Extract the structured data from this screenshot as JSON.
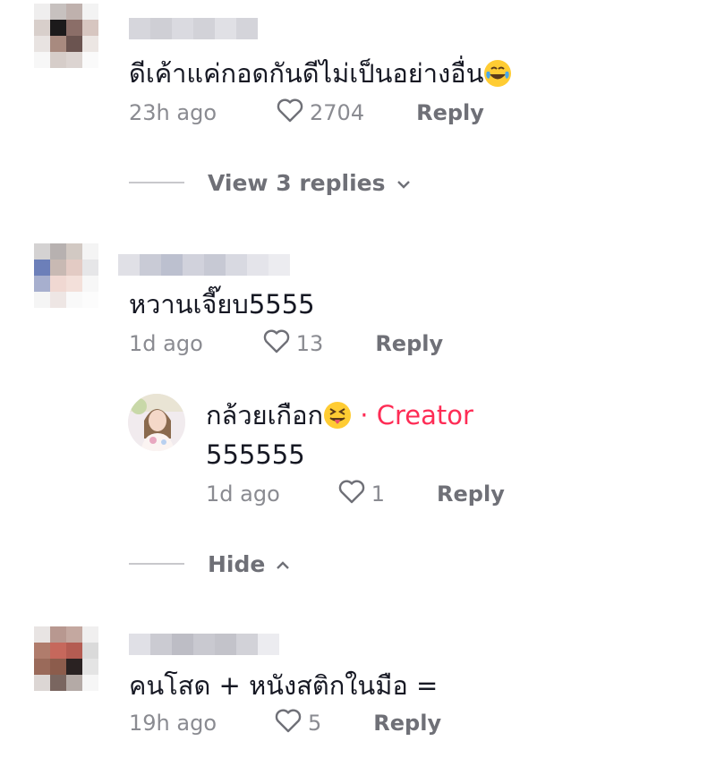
{
  "comments": [
    {
      "text": "ดีเค้าแค่กอดกันดีไม่เป็นอย่างอื่น",
      "emoji": "laughing-tears-emoji",
      "time": "23h ago",
      "likes": "2704",
      "reply_label": "Reply",
      "toggle_label": "View 3 replies",
      "toggle_icon": "chevron-down-icon"
    },
    {
      "text": "หวานเจี๊ยบ5555",
      "time": "1d ago",
      "likes": "13",
      "reply_label": "Reply",
      "replies": [
        {
          "author": "กล้วยเกือก",
          "author_emoji": "tongue-out-emoji",
          "badge": "· Creator",
          "text": "555555",
          "time": "1d ago",
          "likes": "1",
          "reply_label": "Reply"
        }
      ],
      "toggle_label": "Hide",
      "toggle_icon": "chevron-up-icon"
    },
    {
      "text": "คนโสด + หนังสติกในมือ =",
      "time": "19h ago",
      "likes": "5",
      "reply_label": "Reply"
    }
  ],
  "colors": {
    "accent": "#fe2c55",
    "muted": "#8a8b91",
    "reply": "#6f7077"
  }
}
